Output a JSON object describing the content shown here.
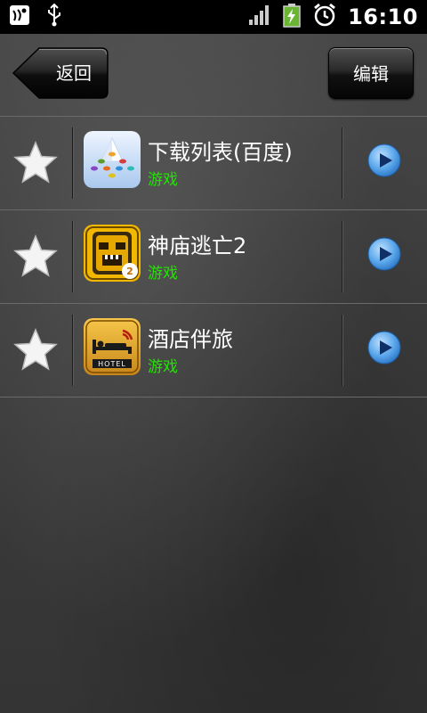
{
  "status_bar": {
    "time": "16:10",
    "icons": [
      "notification-icon",
      "usb-icon",
      "signal-icon",
      "battery-charging-icon",
      "alarm-icon"
    ]
  },
  "top_bar": {
    "back_label": "返回",
    "edit_label": "编辑"
  },
  "colors": {
    "category_text": "#22e400",
    "play_button": "#3a8fd8"
  },
  "items": [
    {
      "name": "下载列表(百度)",
      "category": "游戏",
      "icon": "baidu-download-list-icon"
    },
    {
      "name": "神庙逃亡2",
      "category": "游戏",
      "icon": "temple-run-2-icon"
    },
    {
      "name": "酒店伴旅",
      "category": "游戏",
      "icon": "hotel-companion-icon"
    }
  ]
}
